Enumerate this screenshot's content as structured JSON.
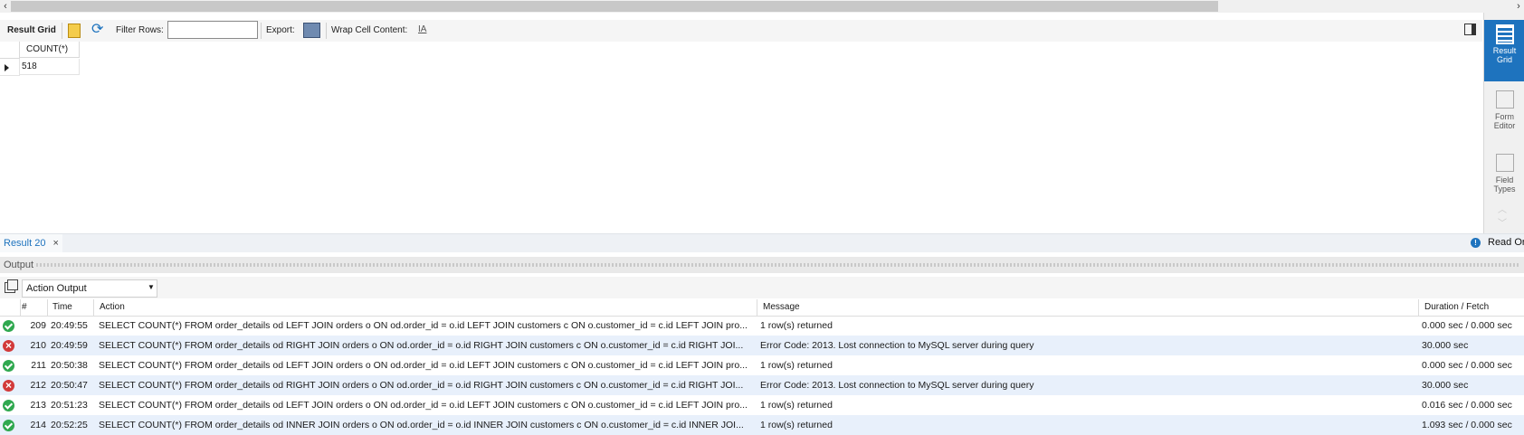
{
  "toolbar": {
    "result_grid_label": "Result Grid",
    "filter_rows_label": "Filter Rows:",
    "filter_rows_value": "",
    "export_label": "Export:",
    "wrap_label": "Wrap Cell Content:"
  },
  "grid": {
    "columns": [
      "COUNT(*)"
    ],
    "rows": [
      [
        "518"
      ]
    ]
  },
  "side_panel": {
    "result_grid": "Result Grid",
    "form_editor": "Form Editor",
    "field_types": "Field Types"
  },
  "result_tab": {
    "label": "Result 20",
    "close": "×"
  },
  "read_only": "Read Or",
  "output": {
    "title": "Output",
    "selector_value": "Action Output",
    "columns": [
      "#",
      "Time",
      "Action",
      "Message",
      "Duration / Fetch"
    ],
    "rows": [
      {
        "status": "ok",
        "num": "209",
        "time": "20:49:55",
        "action": "SELECT COUNT(*) FROM order_details od LEFT JOIN orders o ON od.order_id = o.id LEFT JOIN customers c ON o.customer_id = c.id LEFT JOIN pro...",
        "message": "1 row(s) returned",
        "duration": "0.000 sec / 0.000 sec"
      },
      {
        "status": "error",
        "num": "210",
        "time": "20:49:59",
        "action": "SELECT COUNT(*) FROM order_details od RIGHT JOIN orders o ON od.order_id = o.id RIGHT JOIN customers c ON o.customer_id = c.id RIGHT JOI...",
        "message": "Error Code: 2013. Lost connection to MySQL server during query",
        "duration": "30.000 sec"
      },
      {
        "status": "ok",
        "num": "211",
        "time": "20:50:38",
        "action": "SELECT COUNT(*) FROM order_details od LEFT JOIN orders o ON od.order_id = o.id LEFT JOIN customers c ON o.customer_id = c.id LEFT JOIN pro...",
        "message": "1 row(s) returned",
        "duration": "0.000 sec / 0.000 sec"
      },
      {
        "status": "error",
        "num": "212",
        "time": "20:50:47",
        "action": "SELECT COUNT(*) FROM order_details od RIGHT JOIN orders o ON od.order_id = o.id RIGHT JOIN customers c ON o.customer_id = c.id RIGHT JOI...",
        "message": "Error Code: 2013. Lost connection to MySQL server during query",
        "duration": "30.000 sec"
      },
      {
        "status": "ok",
        "num": "213",
        "time": "20:51:23",
        "action": "SELECT COUNT(*) FROM order_details od LEFT JOIN orders o ON od.order_id = o.id LEFT JOIN customers c ON o.customer_id = c.id LEFT JOIN pro...",
        "message": "1 row(s) returned",
        "duration": "0.016 sec / 0.000 sec"
      },
      {
        "status": "ok",
        "num": "214",
        "time": "20:52:25",
        "action": "SELECT COUNT(*) FROM order_details od INNER JOIN orders o ON od.order_id = o.id INNER JOIN customers c ON o.customer_id = c.id INNER JOI...",
        "message": "1 row(s) returned",
        "duration": "1.093 sec / 0.000 sec"
      }
    ]
  },
  "colors": {
    "accent": "#1e73be",
    "ok": "#2fa84f",
    "error": "#d23a3a",
    "alt_row": "#e8f0fb"
  }
}
